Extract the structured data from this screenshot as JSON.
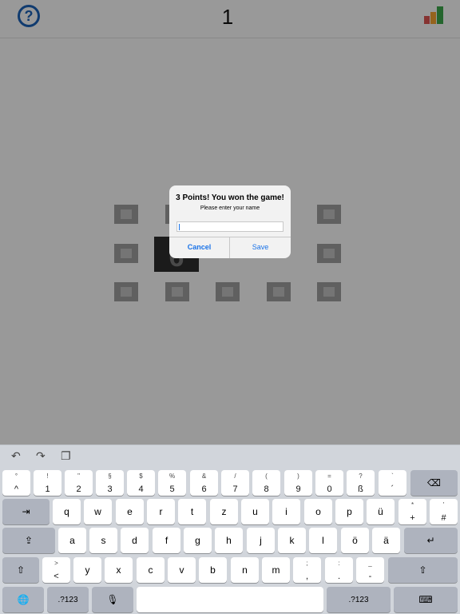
{
  "header": {
    "help_icon": "?",
    "counter": "1",
    "stats_icon": "bar-chart-icon"
  },
  "board": {
    "big_tile_label": "6"
  },
  "dialog": {
    "title": "3 Points! You won the game!",
    "message": "Please enter your name",
    "input_value": "",
    "cancel_label": "Cancel",
    "save_label": "Save"
  },
  "keyboard": {
    "toolbar": {
      "undo": "↶",
      "redo": "↷",
      "paste": "❐"
    },
    "number_row": [
      {
        "top": "°",
        "bot": "^"
      },
      {
        "top": "!",
        "bot": "1"
      },
      {
        "top": "\"",
        "bot": "2"
      },
      {
        "top": "§",
        "bot": "3"
      },
      {
        "top": "$",
        "bot": "4"
      },
      {
        "top": "%",
        "bot": "5"
      },
      {
        "top": "&",
        "bot": "6"
      },
      {
        "top": "/",
        "bot": "7"
      },
      {
        "top": "(",
        "bot": "8"
      },
      {
        "top": ")",
        "bot": "9"
      },
      {
        "top": "=",
        "bot": "0"
      },
      {
        "top": "?",
        "bot": "ß"
      },
      {
        "top": "`",
        "bot": "´"
      }
    ],
    "backspace": "⌫",
    "tab": "⇥",
    "row_q": [
      "q",
      "w",
      "e",
      "r",
      "t",
      "z",
      "u",
      "i",
      "o",
      "p",
      "ü"
    ],
    "plus_key": {
      "top": "*",
      "bot": "+"
    },
    "hash_key": {
      "top": "'",
      "bot": "#"
    },
    "caps": "⇪",
    "row_a": [
      "a",
      "s",
      "d",
      "f",
      "g",
      "h",
      "j",
      "k",
      "l",
      "ö",
      "ä"
    ],
    "return": "↵",
    "shift": "⇧",
    "angle_key": {
      "top": ">",
      "bot": "<"
    },
    "row_y": [
      "y",
      "x",
      "c",
      "v",
      "b",
      "n",
      "m"
    ],
    "semicolon_key": {
      "top": ";",
      "bot": ","
    },
    "colon_key": {
      "top": ":",
      "bot": "."
    },
    "underscore_key": {
      "top": "_",
      "bot": "-"
    },
    "globe": "🌐",
    "num_label": ".?123",
    "mic": "🎙",
    "hide_kb": "⌨"
  }
}
